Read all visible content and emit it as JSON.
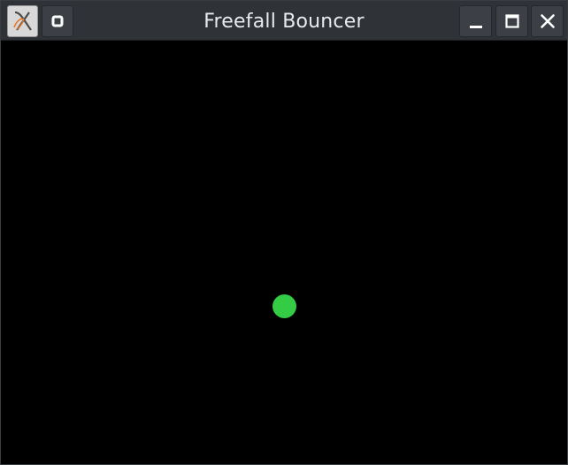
{
  "window": {
    "title": "Freefall Bouncer",
    "app_icon": "x-logo-icon",
    "buttons": {
      "menu_icon": "pin-icon",
      "minimize_icon": "minimize-icon",
      "maximize_icon": "maximize-icon",
      "close_icon": "close-icon"
    }
  },
  "scene": {
    "background_color": "#000000",
    "ball": {
      "shape": "circle",
      "color": "#33cc44"
    }
  },
  "colors": {
    "titlebar": "#2f3338",
    "title_text": "#e9eaec"
  }
}
